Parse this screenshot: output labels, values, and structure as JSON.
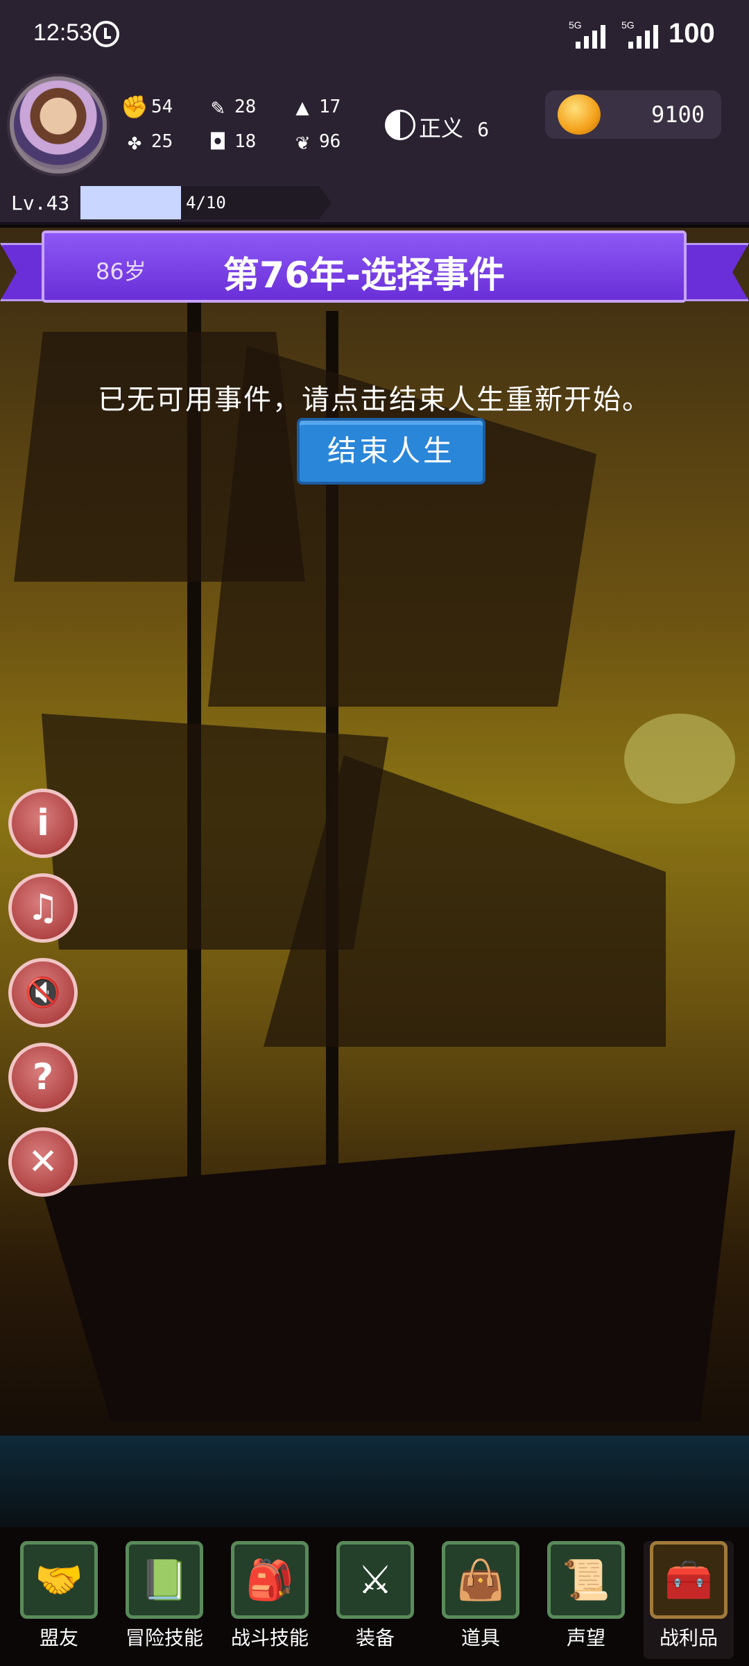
{
  "status_bar": {
    "time": "12:53",
    "network1": "5G",
    "network2": "5G",
    "battery": "100"
  },
  "header": {
    "stats": [
      {
        "icon": "fist-icon",
        "value": "54"
      },
      {
        "icon": "quill-icon",
        "value": "28"
      },
      {
        "icon": "wizard-hat-icon",
        "value": "17"
      },
      {
        "icon": "clover-icon",
        "value": "25"
      },
      {
        "icon": "chest-armor-icon",
        "value": "18"
      },
      {
        "icon": "wings-icon",
        "value": "96"
      }
    ],
    "morality_label": "正义",
    "morality_value": "6",
    "coins": "9100",
    "level": "Lv.43",
    "xp_text": "4/10",
    "xp_fraction": 0.4
  },
  "banner": {
    "age": "86岁",
    "title": "第76年-选择事件"
  },
  "main": {
    "message": "已无可用事件，请点击结束人生重新开始。",
    "end_button": "结束人生"
  },
  "side_buttons": [
    {
      "name": "info-button",
      "icon": "info-icon",
      "glyph": "i"
    },
    {
      "name": "music-off-button",
      "icon": "music-off-icon",
      "glyph": "♫"
    },
    {
      "name": "sound-off-button",
      "icon": "sound-off-icon",
      "glyph": "🔇"
    },
    {
      "name": "help-button",
      "icon": "help-icon",
      "glyph": "?"
    },
    {
      "name": "close-button",
      "icon": "close-icon",
      "glyph": "✕"
    }
  ],
  "bottom_nav": [
    {
      "label": "盟友",
      "icon": "handshake-icon",
      "glyph": "🤝"
    },
    {
      "label": "冒险技能",
      "icon": "spellbook-icon",
      "glyph": "📗"
    },
    {
      "label": "战斗技能",
      "icon": "satchel-icon",
      "glyph": "🎒"
    },
    {
      "label": "装备",
      "icon": "crossed-swords-icon",
      "glyph": "⚔"
    },
    {
      "label": "道具",
      "icon": "pouch-icon",
      "glyph": "👜"
    },
    {
      "label": "声望",
      "icon": "scroll-icon",
      "glyph": "📜"
    },
    {
      "label": "战利品",
      "icon": "treasure-chest-icon",
      "glyph": "🧰"
    }
  ]
}
